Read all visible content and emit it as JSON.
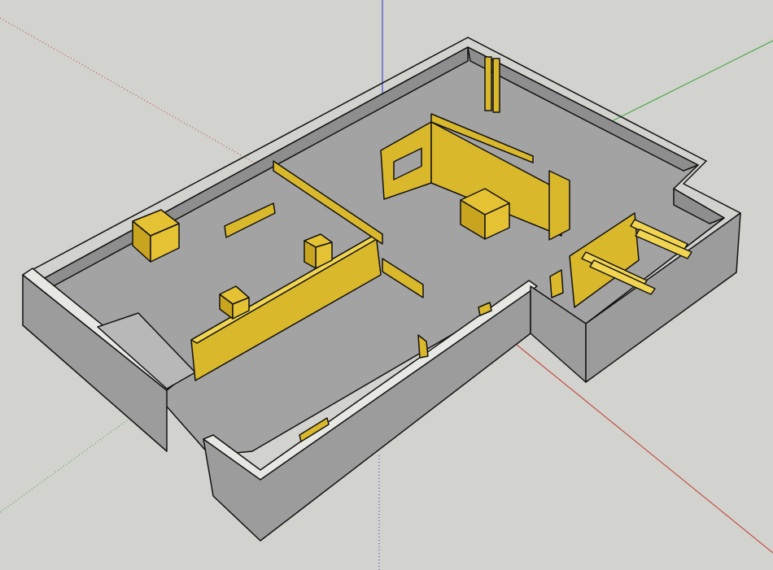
{
  "scene": {
    "colors": {
      "background": "#d2d2ce",
      "floor": "#a3a3a3",
      "wall_top": "#e7e7e3",
      "wall_inner": "#8e8e8e",
      "wall_outer": "#9c9c9c",
      "partition_face": "#dab82c",
      "partition_top": "#f1d552",
      "box_face": "#e5c234",
      "box_side": "#c9a41f",
      "red_axis": "#c0392b",
      "green_axis": "#2ea02e",
      "blue_axis": "#2c2ccf",
      "edge": "#111111"
    },
    "axes": [
      "red-axis",
      "green-axis",
      "blue-axis"
    ],
    "objects": [
      "basement-shell",
      "main-partition-wall",
      "upper-room-partition",
      "right-stair-frame",
      "storage-box"
    ]
  }
}
